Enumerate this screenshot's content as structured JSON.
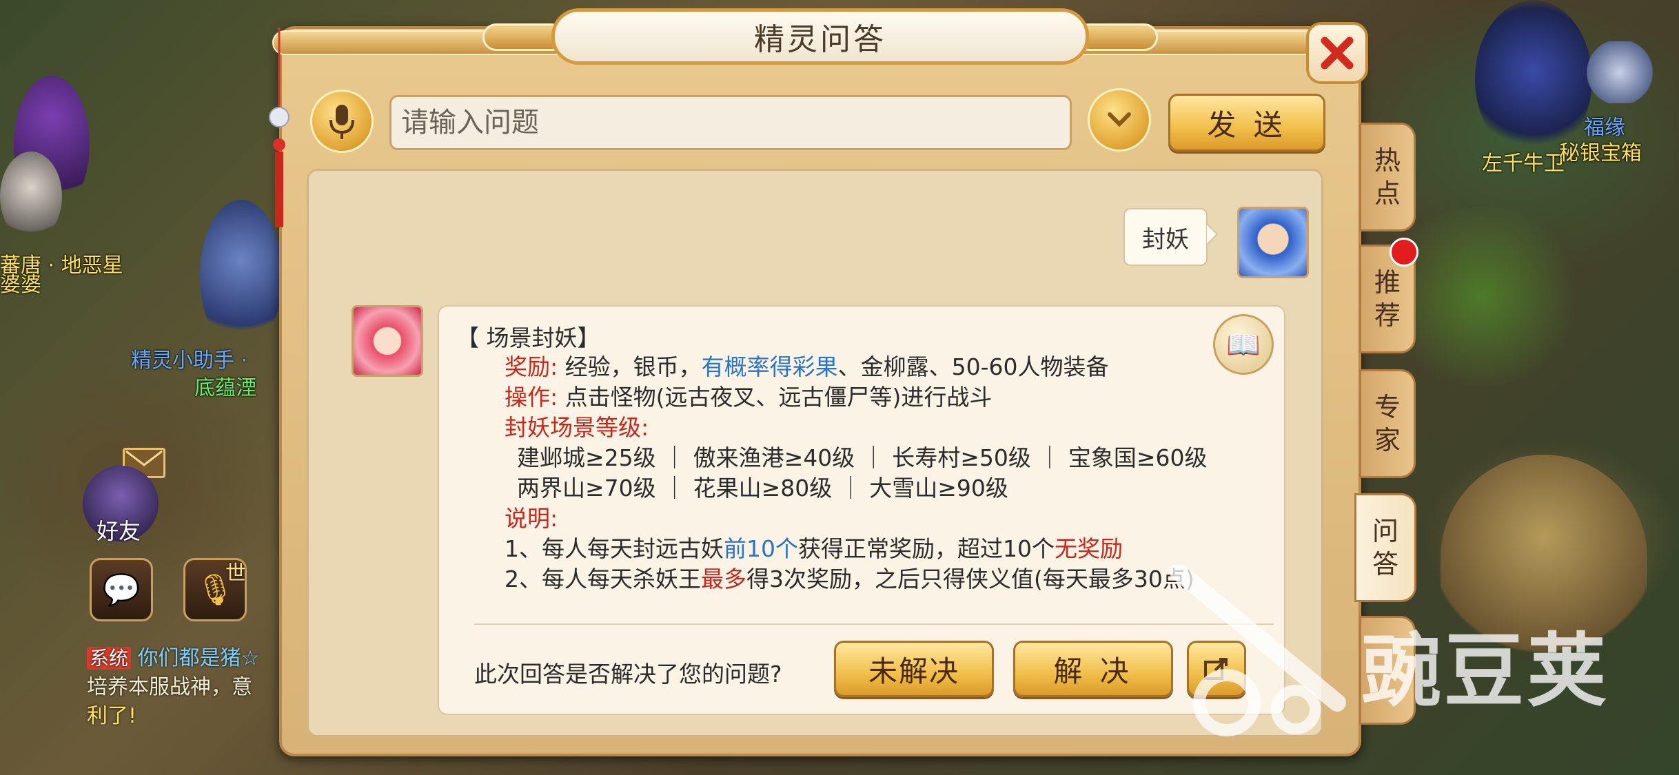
{
  "dialog": {
    "title": "精灵问答",
    "input_placeholder": "请输入问题",
    "send_label": "发 送"
  },
  "side_tabs": [
    {
      "label_top": "热",
      "label_bottom": "点"
    },
    {
      "label_top": "推",
      "label_bottom": "荐"
    },
    {
      "label_top": "专",
      "label_bottom": "家"
    },
    {
      "label_top": "问",
      "label_bottom": "答"
    }
  ],
  "chat": {
    "user_question": "封妖",
    "answer": {
      "heading": "【 场景封妖】",
      "reward_label": "奖励:",
      "reward_text_a": " 经验，银币，",
      "reward_highlight": "有概率得彩果",
      "reward_text_b": "、金柳露、50-60人物装备",
      "operation_label": "操作:",
      "operation_text": " 点击怪物(远古夜叉、远古僵尸等)进行战斗",
      "level_label": "封妖场景等级:",
      "levels_row1": "建邺城≥25级 ｜ 傲来渔港≥40级 ｜ 长寿村≥50级 ｜ 宝象国≥60级",
      "levels_row2": "两界山≥70级   ｜   花果山≥80级   ｜   大雪山≥90级",
      "note_label": "说明:",
      "note1_a": "1、每人每天封远古妖",
      "note1_highlight": "前10个",
      "note1_b": "获得正常奖励，超过10个",
      "note1_red": "无奖励",
      "note2_a": "2、每人每天杀妖王",
      "note2_red": "最多",
      "note2_b": "得3次奖励，之后只得侠义值(每天最多30点)"
    },
    "feedback_question": "此次回答是否解决了您的问题?",
    "unresolved_label": "未解决",
    "resolved_label": "解 决"
  },
  "game_bg": {
    "npc_labels": [
      "蕃唐 · 地恶星",
      "婆婆",
      "精灵小助手 · ",
      "底蕴湮",
      "左千牛卫",
      "福缘",
      "秘银宝箱"
    ],
    "friend_label": "好友",
    "world_badge": "世",
    "chat_tag": "系统",
    "chat_line1": "你们都是猪☆",
    "chat_line2": "培养本服战神，意",
    "chat_line3": "利了!"
  },
  "watermark": "豌豆荚"
}
